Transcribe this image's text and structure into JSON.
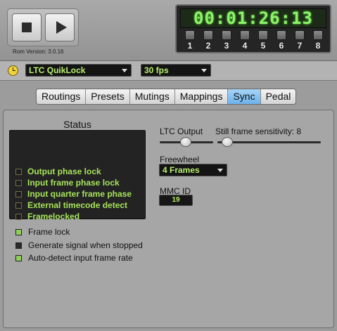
{
  "transport": {
    "stop_icon": "stop-icon",
    "play_icon": "play-icon"
  },
  "rom_version": "Rom Version: 3.0.16",
  "timecode": {
    "display": "00:01:26:13",
    "keys": [
      "1",
      "2",
      "3",
      "4",
      "5",
      "6",
      "7",
      "8"
    ]
  },
  "sync_source": {
    "icon": "clock-icon",
    "source": "LTC QuikLock",
    "frame_rate": "30 fps"
  },
  "tabs": [
    {
      "label": "Routings"
    },
    {
      "label": "Presets"
    },
    {
      "label": "Mutings"
    },
    {
      "label": "Mappings"
    },
    {
      "label": "Sync",
      "active": true
    },
    {
      "label": "Pedal"
    }
  ],
  "status": {
    "title": "Status",
    "items": [
      "Output phase lock",
      "Input frame phase lock",
      "Input quarter frame phase",
      "External timecode detect",
      "Framelocked"
    ]
  },
  "options": [
    {
      "label": "Frame lock",
      "on": true
    },
    {
      "label": "Generate signal when stopped",
      "on": false
    },
    {
      "label": "Auto-detect input frame rate",
      "on": true
    }
  ],
  "ltc_output": {
    "label": "LTC Output",
    "level": 0.5
  },
  "still_frame": {
    "label": "Still frame sensitivity: 8",
    "level": 0.05
  },
  "freewheel": {
    "label": "Freewheel",
    "value": "4 Frames"
  },
  "mmc": {
    "label": "MMC ID",
    "value": "19"
  },
  "colors": {
    "led_green": "#8fd05a",
    "tc_green": "#8cf26a",
    "tab_active": "#6db3ec"
  }
}
